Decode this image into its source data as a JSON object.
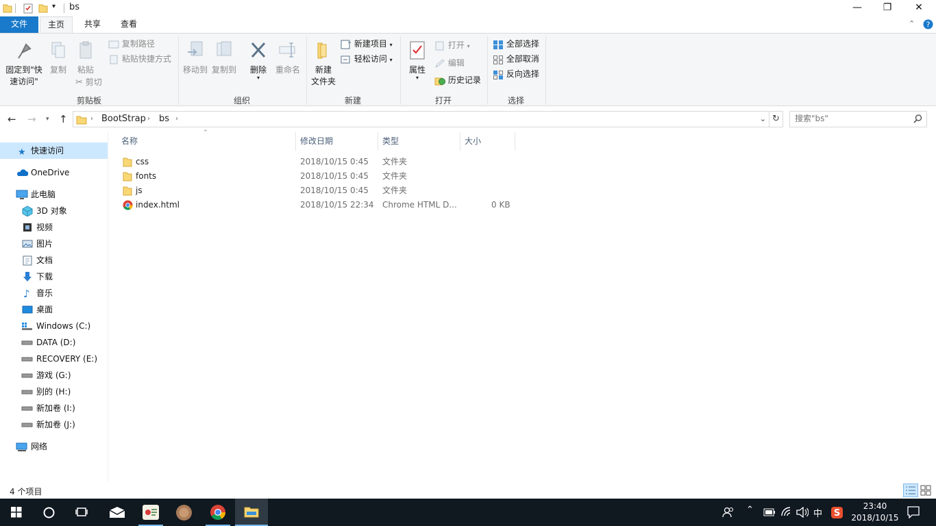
{
  "window": {
    "title": "bs",
    "controls": {
      "minimize": "—",
      "maximize": "❐",
      "close": "✕"
    }
  },
  "ribbon_tabs": [
    {
      "label": "文件"
    },
    {
      "label": "主页"
    },
    {
      "label": "共享"
    },
    {
      "label": "查看"
    }
  ],
  "ribbon": {
    "clipboard": {
      "pin": "固定到\"快速访问\"",
      "copy": "复制",
      "paste": "粘贴",
      "copy_path": "复制路径",
      "paste_shortcut": "粘贴快捷方式",
      "cut": "剪切",
      "label": "剪贴板"
    },
    "organize": {
      "move_to": "移动到",
      "copy_to": "复制到",
      "delete": "删除",
      "rename": "重命名",
      "label": "组织"
    },
    "new": {
      "new_folder": "新建\n文件夹",
      "new_item": "新建项目",
      "easy_access": "轻松访问",
      "label": "新建"
    },
    "open": {
      "properties": "属性",
      "open": "打开",
      "edit": "编辑",
      "history": "历史记录",
      "label": "打开"
    },
    "select": {
      "select_all": "全部选择",
      "select_none": "全部取消",
      "invert": "反向选择",
      "label": "选择"
    }
  },
  "address": {
    "crumbs": [
      "BootStrap",
      "bs"
    ],
    "search_placeholder": "搜索\"bs\""
  },
  "nav_pane": [
    {
      "label": "快速访问",
      "icon": "star-icon",
      "selected": true
    },
    {
      "label": "OneDrive",
      "icon": "cloud-icon"
    },
    {
      "label": "此电脑",
      "icon": "computer-icon"
    },
    {
      "label": "3D 对象",
      "icon": "cube-icon"
    },
    {
      "label": "视频",
      "icon": "video-icon"
    },
    {
      "label": "图片",
      "icon": "picture-icon"
    },
    {
      "label": "文档",
      "icon": "document-icon"
    },
    {
      "label": "下载",
      "icon": "download-icon"
    },
    {
      "label": "音乐",
      "icon": "music-icon"
    },
    {
      "label": "桌面",
      "icon": "desktop-icon"
    },
    {
      "label": "Windows (C:)",
      "icon": "system-drive-icon"
    },
    {
      "label": "DATA (D:)",
      "icon": "drive-icon"
    },
    {
      "label": "RECOVERY (E:)",
      "icon": "drive-icon"
    },
    {
      "label": "游戏 (G:)",
      "icon": "drive-icon"
    },
    {
      "label": "别的 (H:)",
      "icon": "drive-icon"
    },
    {
      "label": "新加卷 (I:)",
      "icon": "drive-icon"
    },
    {
      "label": "新加卷 (J:)",
      "icon": "drive-icon"
    },
    {
      "label": "网络",
      "icon": "network-icon"
    }
  ],
  "columns": {
    "name": "名称",
    "date": "修改日期",
    "type": "类型",
    "size": "大小"
  },
  "files": [
    {
      "name": "css",
      "date": "2018/10/15 0:45",
      "type": "文件夹",
      "size": "",
      "icon": "folder-icon"
    },
    {
      "name": "fonts",
      "date": "2018/10/15 0:45",
      "type": "文件夹",
      "size": "",
      "icon": "folder-icon"
    },
    {
      "name": "js",
      "date": "2018/10/15 0:45",
      "type": "文件夹",
      "size": "",
      "icon": "folder-icon"
    },
    {
      "name": "index.html",
      "date": "2018/10/15 22:34",
      "type": "Chrome HTML D...",
      "size": "0 KB",
      "icon": "chrome-icon"
    }
  ],
  "status": {
    "count": "4 个项目"
  },
  "taskbar": {
    "ime": "中",
    "time": "23:40",
    "date": "2018/10/15"
  },
  "colors": {
    "accent": "#1979ca",
    "selection": "#cce8ff",
    "taskbar": "#101820"
  }
}
